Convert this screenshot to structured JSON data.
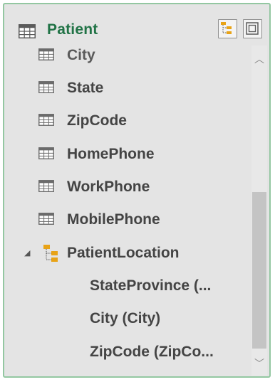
{
  "table": {
    "title": "Patient",
    "title_color": "#217346",
    "header_buttons": [
      {
        "name": "hierarchy-view-icon"
      },
      {
        "name": "frame-view-icon"
      }
    ]
  },
  "fields": [
    {
      "label": "City",
      "icon": "table-field-icon"
    },
    {
      "label": "State",
      "icon": "table-field-icon"
    },
    {
      "label": "ZipCode",
      "icon": "table-field-icon"
    },
    {
      "label": "HomePhone",
      "icon": "table-field-icon"
    },
    {
      "label": "WorkPhone",
      "icon": "table-field-icon"
    },
    {
      "label": "MobilePhone",
      "icon": "table-field-icon"
    }
  ],
  "hierarchy": {
    "label": "PatientLocation",
    "expander": "◢",
    "icon": "hierarchy-icon",
    "levels": [
      {
        "label": "StateProvince (..."
      },
      {
        "label": "City (City)"
      },
      {
        "label": "ZipCode (ZipCo..."
      }
    ]
  },
  "scrollbar": {
    "up": "︿",
    "down": "﹀"
  }
}
